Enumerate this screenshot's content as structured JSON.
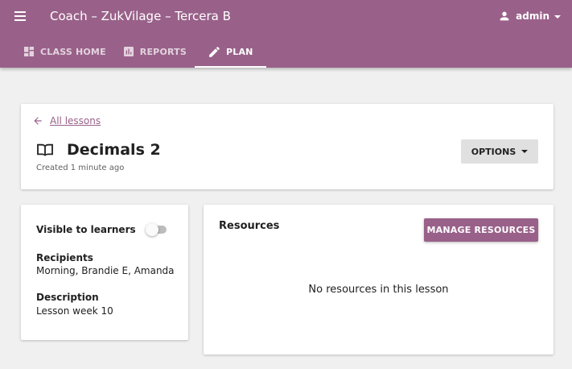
{
  "theme": {
    "brand": "#996189",
    "background": "#f0f0f0"
  },
  "appbar": {
    "title": "Coach – ZukVilage – Tercera B",
    "menu_icon": "hamburger-menu-icon",
    "user": {
      "icon": "person-icon",
      "name": "admin"
    }
  },
  "tabs": [
    {
      "label": "CLASS HOME",
      "icon": "dashboard-icon",
      "active": false
    },
    {
      "label": "REPORTS",
      "icon": "bar-chart-icon",
      "active": false
    },
    {
      "label": "PLAN",
      "icon": "pencil-icon",
      "active": true
    }
  ],
  "lesson": {
    "back_label": "All lessons",
    "title": "Decimals 2",
    "created": "Created 1 minute ago",
    "options_label": "OPTIONS"
  },
  "details": {
    "visible_label": "Visible to learners",
    "visible": false,
    "recipients_label": "Recipients",
    "recipients": "Morning, Brandie E, Amanda",
    "description_label": "Description",
    "description": "Lesson week 10"
  },
  "resources": {
    "title": "Resources",
    "manage_label": "MANAGE RESOURCES",
    "empty_text": "No resources in this lesson"
  }
}
